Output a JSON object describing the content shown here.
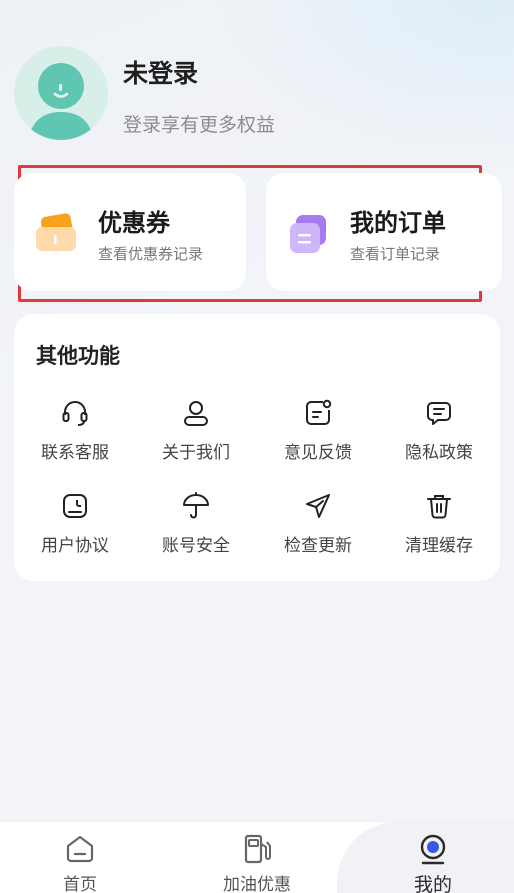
{
  "profile": {
    "name": "未登录",
    "subtitle": "登录享有更多权益"
  },
  "quick_cards": [
    {
      "title": "优惠券",
      "desc": "查看优惠券记录",
      "icon": "coupon-icon"
    },
    {
      "title": "我的订单",
      "desc": "查看订单记录",
      "icon": "order-icon"
    }
  ],
  "other": {
    "title": "其他功能",
    "items": [
      {
        "label": "联系客服",
        "icon": "headset-icon"
      },
      {
        "label": "关于我们",
        "icon": "user-icon"
      },
      {
        "label": "意见反馈",
        "icon": "feedback-icon"
      },
      {
        "label": "隐私政策",
        "icon": "message-icon"
      },
      {
        "label": "用户协议",
        "icon": "document-icon"
      },
      {
        "label": "账号安全",
        "icon": "umbrella-icon"
      },
      {
        "label": "检查更新",
        "icon": "send-icon"
      },
      {
        "label": "清理缓存",
        "icon": "trash-icon"
      }
    ]
  },
  "tabbar": {
    "tabs": [
      {
        "label": "首页",
        "icon": "home-icon"
      },
      {
        "label": "加油优惠",
        "icon": "fuel-pump-icon"
      },
      {
        "label": "我的",
        "icon": "profile-tab-icon",
        "active": true
      }
    ]
  },
  "colors": {
    "highlight_border": "#e03a3a",
    "coupon_orange": "#f7a21b",
    "order_purple": "#a77bf0",
    "active_dot": "#3a55e8",
    "avatar_green": "#5fc6b2"
  }
}
